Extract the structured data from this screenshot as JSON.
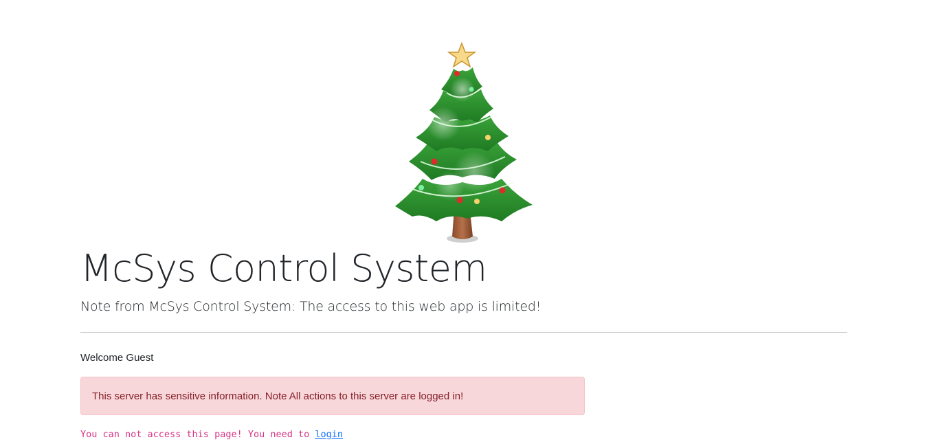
{
  "header": {
    "image_icon": "christmas-tree-icon",
    "title": "McSys Control System",
    "lead": "Note from McSys Control System: The access to this web app is limited!"
  },
  "main": {
    "welcome": "Welcome Guest",
    "alert": {
      "text": "This server has sensitive information. Note All actions to this server are logged in!",
      "background": "#f8d7da",
      "color": "#842029"
    },
    "notice": {
      "text": "You can not access this page! You need to ",
      "link_label": "login",
      "color": "#d63384",
      "link_color": "#0d6efd"
    }
  }
}
